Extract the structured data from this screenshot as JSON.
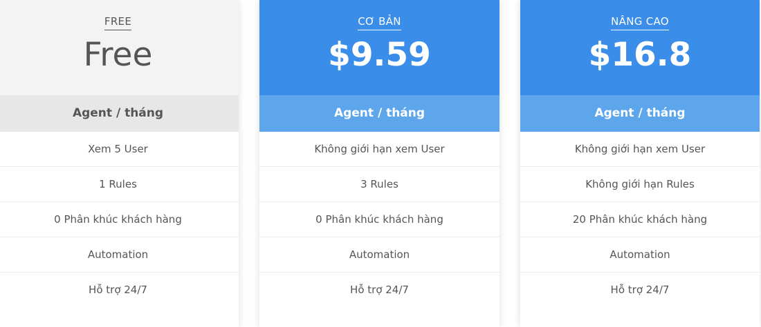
{
  "plans": [
    {
      "name": "FREE",
      "price": "Free",
      "unit": "Agent / tháng",
      "features": [
        "Xem 5 User",
        "1 Rules",
        "0 Phân khúc khách hàng",
        "Automation",
        "Hỗ trợ 24/7"
      ]
    },
    {
      "name": "CƠ BẢN",
      "price": "$9.59",
      "unit": "Agent / tháng",
      "features": [
        "Không giới hạn xem User",
        "3 Rules",
        "0 Phân khúc khách hàng",
        "Automation",
        "Hỗ trợ 24/7"
      ]
    },
    {
      "name": "NÂNG CAO",
      "price": "$16.8",
      "unit": "Agent / tháng",
      "features": [
        "Không giới hạn xem User",
        "Không giới hạn Rules",
        "20 Phân khúc khách hàng",
        "Automation",
        "Hỗ trợ 24/7"
      ]
    }
  ],
  "colors": {
    "accent": "#3a8de8",
    "accent_light": "#5ea6ec",
    "free_header": "#f3f3f3",
    "free_unit": "#e7e7e7",
    "text": "#555555"
  }
}
